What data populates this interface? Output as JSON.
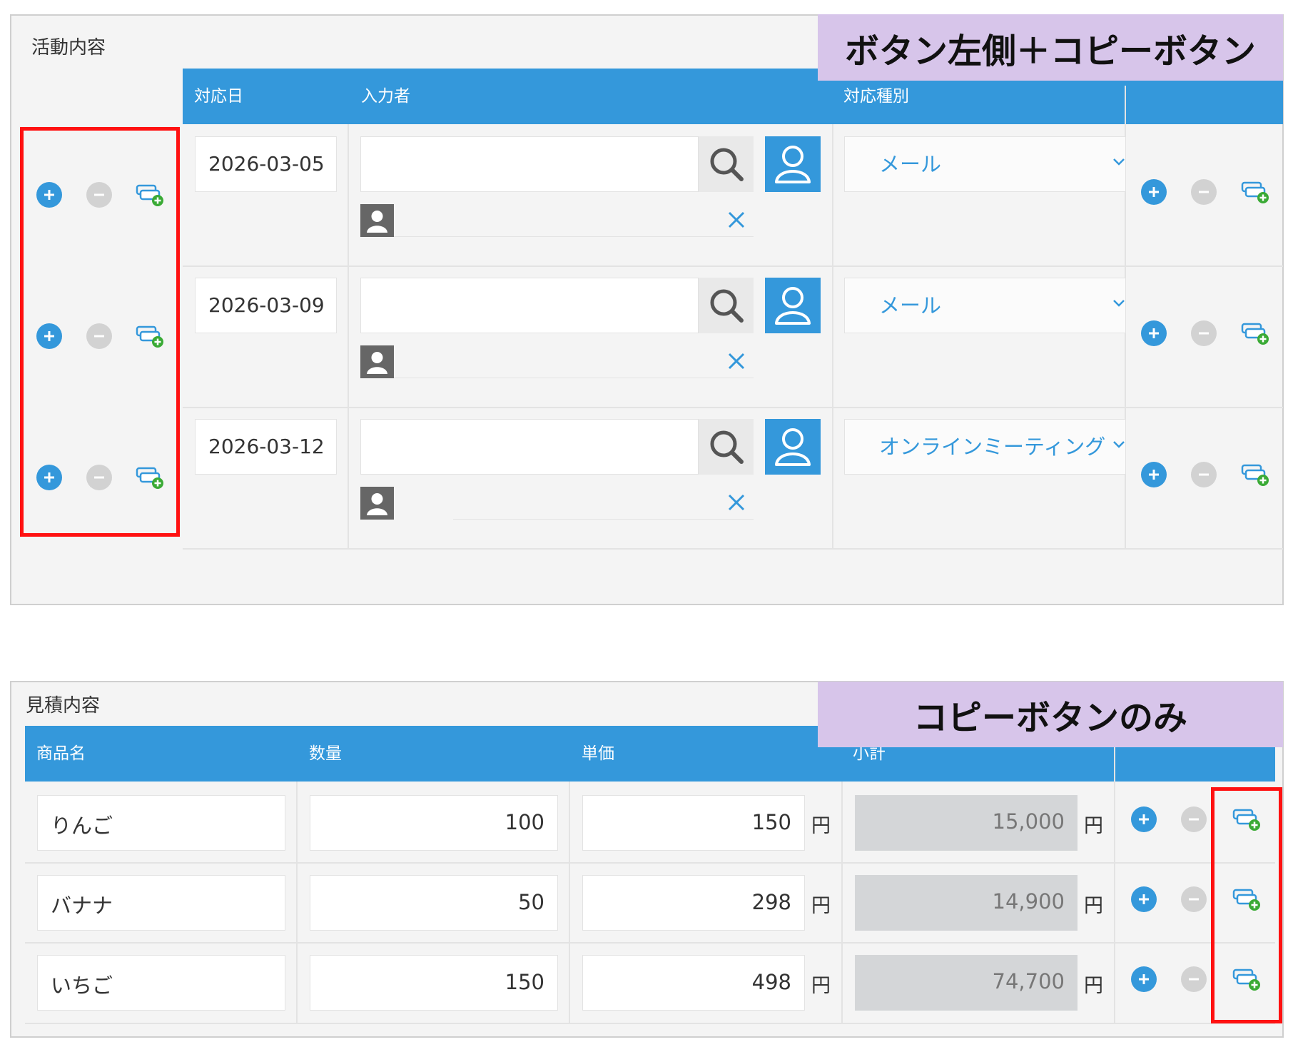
{
  "activity": {
    "title": "活動内容",
    "banner": "ボタン左側＋コピーボタン",
    "columns": {
      "date": "対応日",
      "entered_by": "入力者",
      "type": "対応種別"
    },
    "rows": [
      {
        "date": "2026-03-05",
        "type": "メール"
      },
      {
        "date": "2026-03-09",
        "type": "メール"
      },
      {
        "date": "2026-03-12",
        "type": "オンラインミーティング"
      }
    ]
  },
  "estimate": {
    "title": "見積内容",
    "banner": "コピーボタンのみ",
    "columns": {
      "product": "商品名",
      "qty": "数量",
      "unit_price": "単価",
      "subtotal": "小計"
    },
    "currency": "円",
    "rows": [
      {
        "product": "りんご",
        "qty": "100",
        "unit_price": "150",
        "subtotal": "15,000"
      },
      {
        "product": "バナナ",
        "qty": "50",
        "unit_price": "298",
        "subtotal": "14,900"
      },
      {
        "product": "いちご",
        "qty": "150",
        "unit_price": "498",
        "subtotal": "74,700"
      }
    ]
  },
  "icons": {
    "add": "plus-circle-icon",
    "remove": "minus-circle-icon",
    "copy": "copy-row-icon",
    "search": "search-icon",
    "user": "user-icon",
    "clear": "close-icon",
    "dropdown": "chevron-down-icon"
  },
  "colors": {
    "header": "#3498db",
    "highlight": "#ff1111",
    "banner": "#d7c5ea",
    "copy_plus": "#3aaa35"
  }
}
